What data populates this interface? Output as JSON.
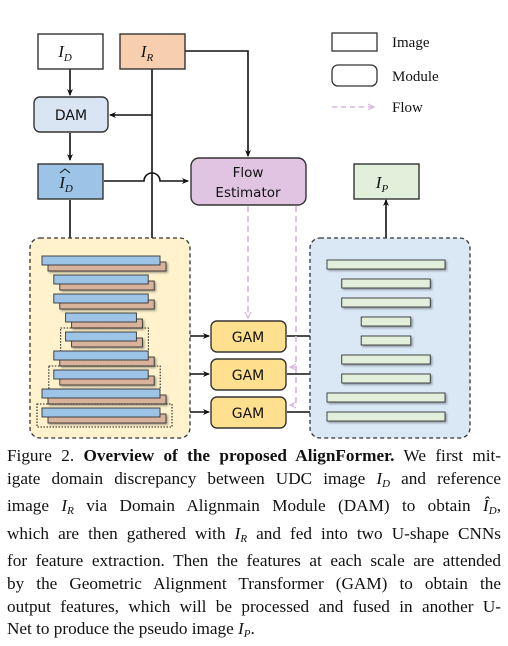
{
  "figure": {
    "nodes": {
      "image_d": {
        "label": "I",
        "sub": "D"
      },
      "image_r": {
        "label": "I",
        "sub": "R"
      },
      "dam": {
        "label": "DAM"
      },
      "image_d_hat": {
        "label": "I",
        "sub": "D",
        "accent": "hat"
      },
      "flow_estimator": {
        "line1": "Flow",
        "line2": "Estimator"
      },
      "image_p": {
        "label": "I",
        "sub": "P"
      },
      "gam": [
        {
          "label": "GAM"
        },
        {
          "label": "GAM"
        },
        {
          "label": "GAM"
        }
      ]
    },
    "legend": {
      "image": "Image",
      "module": "Module",
      "flow": "Flow"
    },
    "colors": {
      "image_r_fill": "#f8cfae",
      "dam_fill": "#dae5f4",
      "image_d_hat_fill": "#9dc3e6",
      "flow_estimator_fill": "#e0c4e2",
      "image_p_fill": "#e2efda",
      "gam_fill": "#ffe08f",
      "encoder_panel_fill": "#fff2cc",
      "decoder_panel_fill": "#dae8f6",
      "feature_blue": "#9dc3e6",
      "feature_brown": "#d9b29b",
      "decoder_bar": "#e2efda",
      "flow_dash": "#d9b6e0"
    },
    "encoder_levels": [
      1.0,
      0.8,
      0.8,
      0.6,
      0.6,
      0.8,
      0.8,
      1.0,
      1.0
    ],
    "decoder_levels": [
      1.0,
      0.75,
      0.75,
      0.42,
      0.42,
      0.75,
      0.75,
      1.0,
      1.0
    ]
  },
  "caption": {
    "label": "Figure 2.",
    "title": "Overview of the proposed AlignFormer.",
    "lines": [
      " We first mit-",
      "igate domain discrepancy between UDC image ",
      " and reference",
      "image ",
      " via Domain Alignmain Module (DAM) to obtain ",
      ",",
      "which are then gathered with ",
      " and fed into two U-shape CNNs",
      "for feature extraction. Then the features at each scale are attended",
      "by the Geometric Alignment Transformer (GAM) to obtain the",
      "output features, which will be processed and fused in another U-",
      "Net to produce the pseudo image ",
      "."
    ],
    "math": {
      "I": "I",
      "D": "D",
      "R": "R",
      "P": "P"
    }
  }
}
